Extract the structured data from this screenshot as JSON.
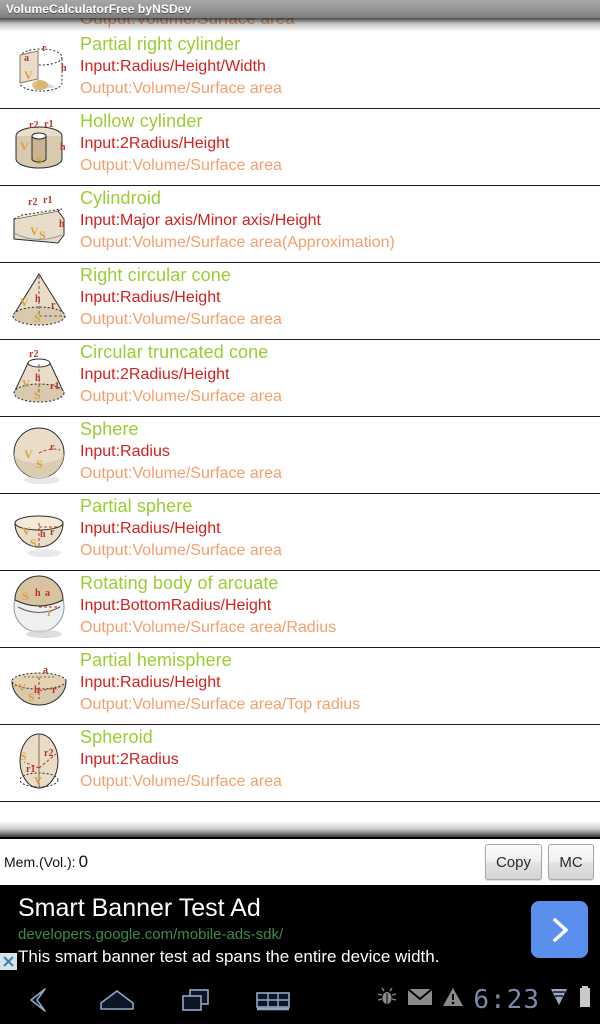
{
  "titlebar": {
    "title": "VolumeCalculatorFree byNSDev"
  },
  "list": {
    "clipped_top_text": "Output:Volume/Surface area",
    "items": [
      {
        "name": "Partial right cylinder",
        "input": "Input:Radius/Height/Width",
        "output": "Output:Volume/Surface area",
        "icon": "partial-right-cylinder-icon"
      },
      {
        "name": "Hollow cylinder",
        "input": "Input:2Radius/Height",
        "output": "Output:Volume/Surface area",
        "icon": "hollow-cylinder-icon"
      },
      {
        "name": "Cylindroid",
        "input": "Input:Major axis/Minor axis/Height",
        "output": "Output:Volume/Surface area(Approximation)",
        "icon": "cylindroid-icon"
      },
      {
        "name": "Right circular cone",
        "input": "Input:Radius/Height",
        "output": "Output:Volume/Surface area",
        "icon": "right-circular-cone-icon"
      },
      {
        "name": "Circular truncated cone",
        "input": "Input:2Radius/Height",
        "output": "Output:Volume/Surface area",
        "icon": "circular-truncated-cone-icon"
      },
      {
        "name": "Sphere",
        "input": "Input:Radius",
        "output": "Output:Volume/Surface area",
        "icon": "sphere-icon"
      },
      {
        "name": "Partial sphere",
        "input": "Input:Radius/Height",
        "output": "Output:Volume/Surface area",
        "icon": "partial-sphere-icon"
      },
      {
        "name": "Rotating body of arcuate",
        "input": "Input:BottomRadius/Height",
        "output": "Output:Volume/Surface area/Radius",
        "icon": "rotating-body-of-arcuate-icon"
      },
      {
        "name": "Partial hemisphere",
        "input": "Input:Radius/Height",
        "output": "Output:Volume/Surface area/Top radius",
        "icon": "partial-hemisphere-icon"
      },
      {
        "name": "Spheroid",
        "input": "Input:2Radius",
        "output": "Output:Volume/Surface area",
        "icon": "spheroid-icon"
      }
    ]
  },
  "memory_bar": {
    "label": "Mem.(Vol.):",
    "value": "0",
    "copy_label": "Copy",
    "mc_label": "MC"
  },
  "ad": {
    "headline": "Smart Banner Test Ad",
    "url": "developers.google.com/mobile-ads-sdk/",
    "description": "This smart banner test ad spans the entire device width.",
    "arrow_icon": "chevron-right-icon",
    "close_icon": "close-icon"
  },
  "system_bar": {
    "back_icon": "back-icon",
    "home_icon": "home-icon",
    "recents_icon": "recent-apps-icon",
    "keyboard_icon": "keyboard-icon",
    "debug_icon": "android-bug-icon",
    "mail_icon": "mail-icon",
    "warning_icon": "warning-icon",
    "clock": "6:23",
    "wifi_icon": "wifi-icon",
    "battery_icon": "battery-icon"
  },
  "colors": {
    "title_green": "#9ACD32",
    "input_red": "#d42020",
    "output_orange": "#f4a06c",
    "ad_url_green": "#3f8a4e",
    "ad_arrow_blue": "#5a8fee",
    "clock_blue": "#7b8aa8"
  }
}
